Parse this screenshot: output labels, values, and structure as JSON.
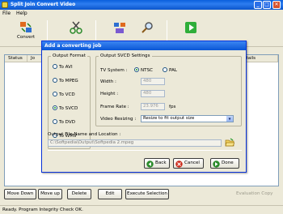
{
  "window": {
    "title": "Split Join Convert Video"
  },
  "menu": {
    "file": "File",
    "help": "Help"
  },
  "toolbar": {
    "convert_label": "Convert"
  },
  "list": {
    "columns": [
      "Status",
      "Jo",
      "etails"
    ]
  },
  "buttons": {
    "move_down": "Move Down",
    "move_up": "Move up",
    "delete": "Delete",
    "edit": "Edit",
    "execute": "Execute Selection"
  },
  "eval_label": "Evaluation Copy",
  "status": "Ready. Program Integrity Check OK.",
  "dialog": {
    "title": "Add a converting job",
    "output_format": {
      "label": "Output Format",
      "options": [
        "To AVI",
        "To MPEG",
        "To VCD",
        "To SVCD",
        "To DVD",
        "To WMV"
      ],
      "selected": "To SVCD"
    },
    "svcd": {
      "label": "Output SVCD Settings",
      "tv_system_label": "TV System :",
      "tv_options": [
        "NTSC",
        "PAL"
      ],
      "tv_selected": "NTSC",
      "width_label": "Width :",
      "width": "480",
      "height_label": "Height :",
      "height": "480",
      "frame_rate_label": "Frame Rate :",
      "frame_rate": "23.976",
      "fps": "fps",
      "resizing_label": "Video Resizing :",
      "resizing": "Resize to fit output size"
    },
    "output_file": {
      "label": "Output File Name and Location :",
      "path": "C:\\Softpedia\\Output\\Softpedia 2.mpeg"
    },
    "back": "Back",
    "cancel": "Cancel",
    "done": "Done"
  },
  "colors": {
    "title_blue": "#0a56d5",
    "face": "#ece9d8",
    "radio_selected": "#21a121"
  }
}
